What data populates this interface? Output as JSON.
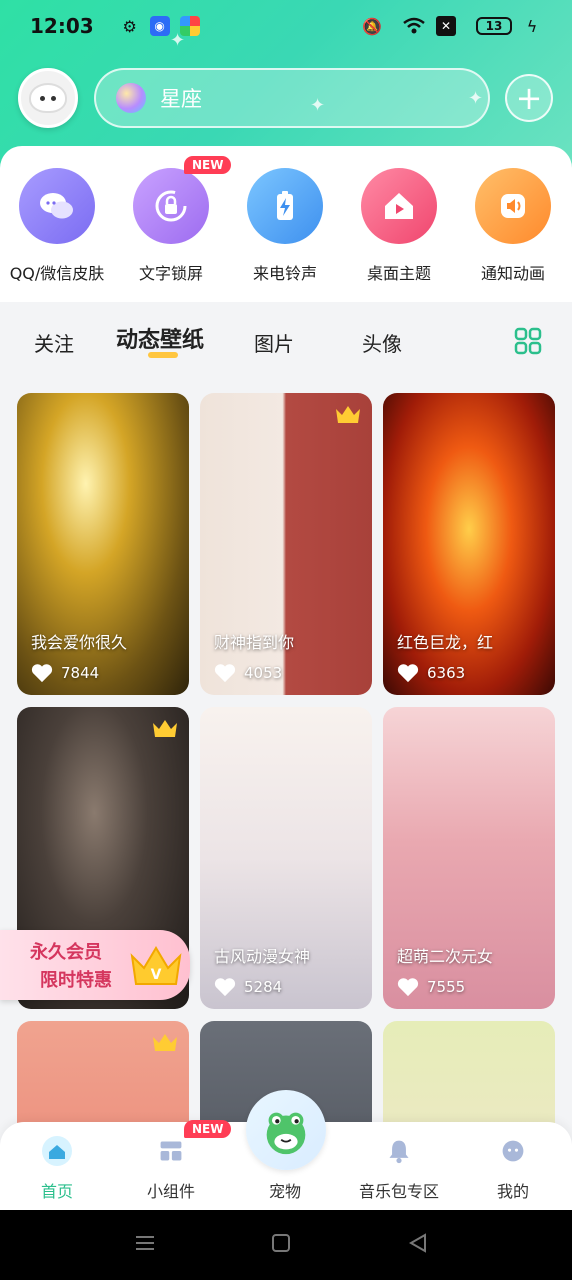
{
  "status_bar": {
    "time": "12:03",
    "battery": "13"
  },
  "search": {
    "placeholder": "星座"
  },
  "features": [
    {
      "label": "QQ/微信皮肤",
      "icon": "chat-bubbles-icon",
      "color": "#8b7cf6"
    },
    {
      "label": "文字锁屏",
      "icon": "lock-rotate-icon",
      "color": "#b07cf2",
      "badge": "NEW"
    },
    {
      "label": "来电铃声",
      "icon": "battery-bolt-icon",
      "color": "#4aa3f5"
    },
    {
      "label": "桌面主题",
      "icon": "home-play-icon",
      "color": "#f55a7c"
    },
    {
      "label": "通知动画",
      "icon": "speaker-icon",
      "color": "#ff9a3c"
    }
  ],
  "tabs": [
    {
      "label": "关注"
    },
    {
      "label": "动态壁纸",
      "active": true
    },
    {
      "label": "图片"
    },
    {
      "label": "头像"
    }
  ],
  "cards": [
    {
      "title": "我会爱你很久",
      "likes": "7844",
      "crown": false
    },
    {
      "title": "财神指到你",
      "likes": "4053",
      "crown": true
    },
    {
      "title": "红色巨龙，红",
      "likes": "6363",
      "crown": false
    },
    {
      "title": "",
      "likes": "",
      "crown": true
    },
    {
      "title": "古风动漫女神",
      "likes": "5284",
      "crown": false
    },
    {
      "title": "超萌二次元女",
      "likes": "7555",
      "crown": false
    },
    {
      "title": "",
      "likes": "",
      "crown": true
    },
    {
      "title": "",
      "likes": "",
      "crown": false
    },
    {
      "title": "",
      "likes": "",
      "crown": false
    }
  ],
  "vip_banner": {
    "line1": "永久会员",
    "line2": "限时特惠"
  },
  "bottom_nav": [
    {
      "label": "首页",
      "active": true
    },
    {
      "label": "小组件",
      "badge": "NEW"
    },
    {
      "label": "宠物"
    },
    {
      "label": "音乐包专区"
    },
    {
      "label": "我的"
    }
  ],
  "colors": {
    "accent": "#2bbf8c",
    "header": "#3ad8b4",
    "badge": "#ff3d55",
    "underline": "#ffc640"
  }
}
